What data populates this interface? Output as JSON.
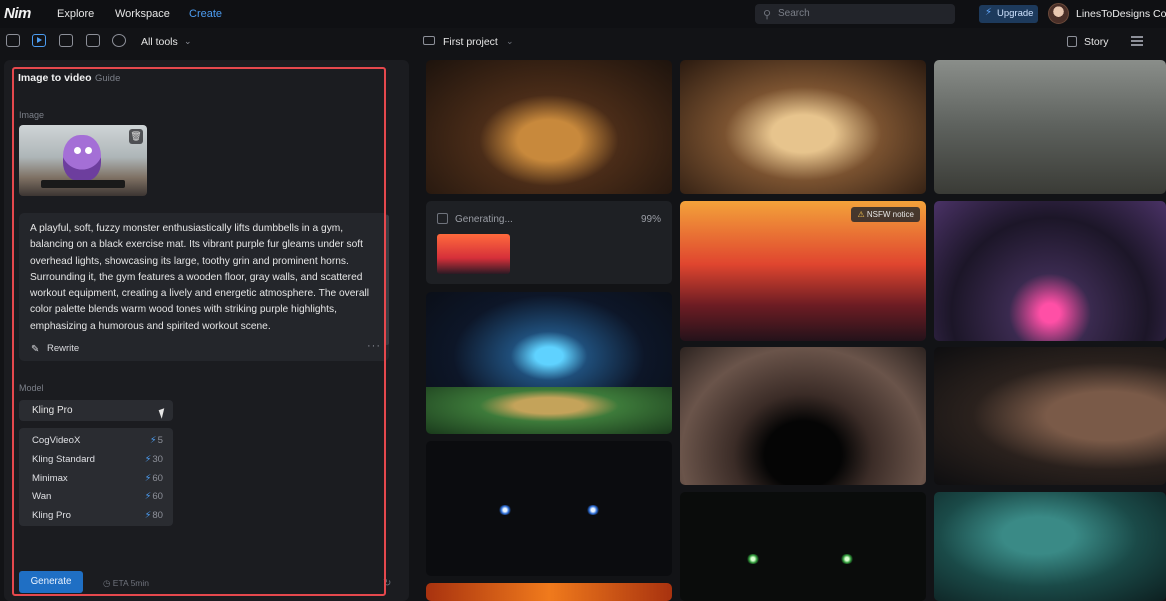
{
  "header": {
    "logo": "Nim",
    "nav": [
      "Explore",
      "Workspace",
      "Create"
    ],
    "search_placeholder": "Search",
    "upgrade_label": "Upgrade",
    "username": "LinesToDesigns Co"
  },
  "toolbar": {
    "all_tools_label": "All tools",
    "project_name": "First project",
    "story_label": "Story"
  },
  "panel": {
    "title": "Image to video",
    "guide_label": "Guide",
    "image_label": "Image",
    "prompt": "A playful, soft, fuzzy monster enthusiastically lifts dumbbells in a gym, balancing on a black exercise mat. Its vibrant purple fur gleams under soft overhead lights, showcasing its large, toothy grin and prominent horns. Surrounding it, the gym features a wooden floor, gray walls, and scattered workout equipment, creating a lively and energetic atmosphere. The overall color palette blends warm wood tones with striking purple highlights, emphasizing a humorous and spirited workout scene.",
    "rewrite_label": "Rewrite",
    "model_label": "Model",
    "selected_model": "Kling Pro",
    "models": [
      {
        "name": "CogVideoX",
        "cost": "5"
      },
      {
        "name": "Kling Standard",
        "cost": "30"
      },
      {
        "name": "Minimax",
        "cost": "60"
      },
      {
        "name": "Wan",
        "cost": "60"
      },
      {
        "name": "Kling Pro",
        "cost": "80"
      }
    ],
    "generate_label": "Generate",
    "eta_label": "ETA 5min"
  },
  "gallery": {
    "generating_label": "Generating...",
    "generating_progress": "99%",
    "nsfw_label": "NSFW notice"
  },
  "colors": {
    "accent": "#4c9cf0",
    "generate_button": "#1f6fc4",
    "highlight_outline": "#e5484d"
  }
}
